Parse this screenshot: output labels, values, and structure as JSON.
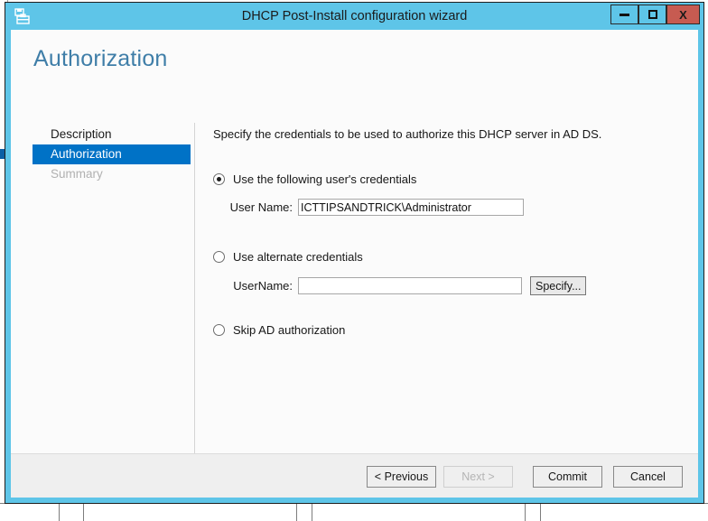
{
  "window": {
    "title": "DHCP Post-Install configuration wizard",
    "icon": "wizard-toolbox-icon",
    "controls": {
      "minimize": "minimize-icon",
      "maximize": "maximize-icon",
      "close": "X"
    },
    "colors": {
      "titlebar": "#5ec5e8",
      "close_button": "#c75b51",
      "accent": "#0072c6",
      "heading": "#3f7ea8",
      "footer": "#efefef"
    }
  },
  "page": {
    "heading": "Authorization"
  },
  "nav": {
    "items": [
      {
        "label": "Description",
        "state": "normal"
      },
      {
        "label": "Authorization",
        "state": "active"
      },
      {
        "label": "Summary",
        "state": "disabled"
      }
    ]
  },
  "main": {
    "intro": "Specify the credentials to be used to authorize this DHCP server in AD DS.",
    "options": [
      {
        "label": "Use the following user's credentials",
        "checked": true,
        "field_label": "User Name:",
        "field_value": "ICTTIPSANDTRICK\\Administrator",
        "field_placeholder": ""
      },
      {
        "label": "Use alternate credentials",
        "checked": false,
        "field_label": "UserName:",
        "field_value": "",
        "field_placeholder": "",
        "button_label": "Specify..."
      },
      {
        "label": "Skip AD authorization",
        "checked": false
      }
    ]
  },
  "footer": {
    "buttons": [
      {
        "label": "< Previous",
        "disabled": false
      },
      {
        "label": "Next >",
        "disabled": true
      },
      {
        "label": "Commit",
        "disabled": false
      },
      {
        "label": "Cancel",
        "disabled": false
      }
    ]
  }
}
